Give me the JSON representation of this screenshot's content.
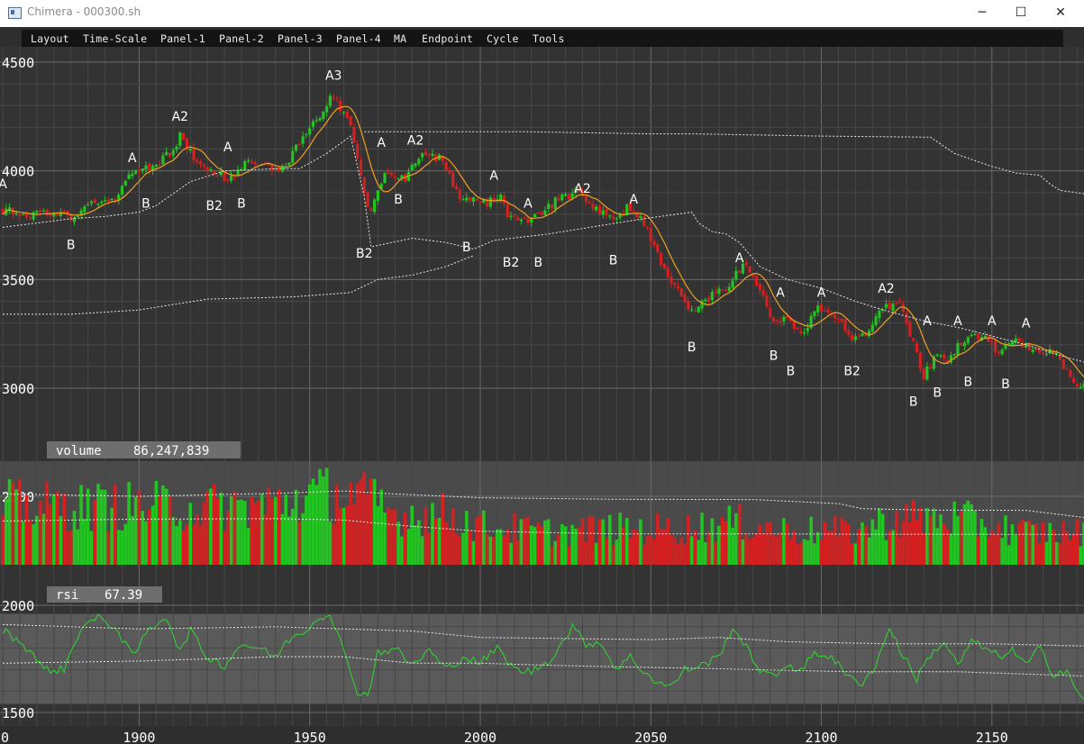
{
  "window": {
    "title": "Chimera - 000300.sh",
    "minimize_glyph": "─",
    "maximize_glyph": "☐",
    "close_glyph": "✕"
  },
  "menu": [
    "Layout",
    "Time-Scale",
    "Panel-1",
    "Panel-2",
    "Panel-3",
    "Panel-4",
    "MA",
    "Endpoint",
    "Cycle",
    "Tools"
  ],
  "colors": {
    "up": "#22c422",
    "down": "#d42020",
    "ma": "#f0a020",
    "rsi_line": "#30d830",
    "grid": "#5a5a5a",
    "label": "#ffffff"
  },
  "panels": {
    "volume": {
      "name": "volume",
      "value": "86,247,839"
    },
    "rsi": {
      "name": "rsi",
      "value": "67.39"
    }
  },
  "chart_data": [
    {
      "type": "candlestick",
      "x_ticks": [
        "1900",
        "1950",
        "2000",
        "2050",
        "2100",
        "2150"
      ],
      "x_edge_label": "0",
      "xlim": [
        1860,
        2177
      ],
      "y_ticks": [
        "4500",
        "4000",
        "3500",
        "3000"
      ],
      "ylim": [
        2960,
        4520
      ],
      "anchors": [
        [
          1860,
          3820
        ],
        [
          1866,
          3800
        ],
        [
          1872,
          3810
        ],
        [
          1880,
          3790
        ],
        [
          1886,
          3850
        ],
        [
          1893,
          3880
        ],
        [
          1898,
          3990
        ],
        [
          1905,
          4020
        ],
        [
          1910,
          4100
        ],
        [
          1912,
          4160
        ],
        [
          1916,
          4060
        ],
        [
          1922,
          3990
        ],
        [
          1927,
          3960
        ],
        [
          1931,
          4030
        ],
        [
          1936,
          4020
        ],
        [
          1942,
          4010
        ],
        [
          1948,
          4150
        ],
        [
          1952,
          4240
        ],
        [
          1957,
          4350
        ],
        [
          1962,
          4200
        ],
        [
          1966,
          3880
        ],
        [
          1968,
          3800
        ],
        [
          1972,
          4010
        ],
        [
          1978,
          3950
        ],
        [
          1982,
          4070
        ],
        [
          1988,
          4060
        ],
        [
          1994,
          3880
        ],
        [
          2002,
          3850
        ],
        [
          2006,
          3900
        ],
        [
          2008,
          3780
        ],
        [
          2013,
          3770
        ],
        [
          2017,
          3790
        ],
        [
          2022,
          3860
        ],
        [
          2028,
          3900
        ],
        [
          2033,
          3840
        ],
        [
          2038,
          3780
        ],
        [
          2043,
          3830
        ],
        [
          2048,
          3760
        ],
        [
          2053,
          3580
        ],
        [
          2058,
          3440
        ],
        [
          2062,
          3360
        ],
        [
          2068,
          3430
        ],
        [
          2073,
          3470
        ],
        [
          2077,
          3570
        ],
        [
          2082,
          3460
        ],
        [
          2086,
          3300
        ],
        [
          2090,
          3340
        ],
        [
          2094,
          3240
        ],
        [
          2099,
          3380
        ],
        [
          2104,
          3340
        ],
        [
          2109,
          3230
        ],
        [
          2113,
          3250
        ],
        [
          2118,
          3360
        ],
        [
          2123,
          3400
        ],
        [
          2127,
          3200
        ],
        [
          2130,
          3060
        ],
        [
          2134,
          3150
        ],
        [
          2137,
          3130
        ],
        [
          2140,
          3190
        ],
        [
          2143,
          3240
        ],
        [
          2148,
          3240
        ],
        [
          2152,
          3160
        ],
        [
          2156,
          3220
        ],
        [
          2162,
          3180
        ],
        [
          2168,
          3170
        ],
        [
          2172,
          3080
        ],
        [
          2176,
          3010
        ]
      ],
      "ma_period": 8,
      "envelope_upper": [
        [
          1966,
          4180
        ],
        [
          2012,
          4180
        ],
        [
          2050,
          4170
        ],
        [
          2062,
          4170
        ],
        [
          2100,
          4160
        ],
        [
          2132,
          4155
        ],
        [
          2139,
          4080
        ],
        [
          2150,
          4020
        ],
        [
          2157,
          3990
        ],
        [
          2164,
          3980
        ],
        [
          2167,
          3940
        ],
        [
          2170,
          3910
        ],
        [
          2177,
          3895
        ]
      ],
      "envelope_lower": [
        [
          1860,
          3740
        ],
        [
          1870,
          3760
        ],
        [
          1880,
          3780
        ],
        [
          1890,
          3790
        ],
        [
          1900,
          3810
        ],
        [
          1905,
          3840
        ],
        [
          1915,
          3950
        ],
        [
          1925,
          4000
        ],
        [
          1940,
          4010
        ],
        [
          1947,
          4010
        ],
        [
          1955,
          4080
        ],
        [
          1962,
          4160
        ],
        [
          1966,
          3880
        ],
        [
          1968,
          3650
        ],
        [
          1980,
          3690
        ],
        [
          1990,
          3670
        ],
        [
          1998,
          3640
        ],
        [
          2004,
          3680
        ],
        [
          2020,
          3710
        ],
        [
          2040,
          3760
        ],
        [
          2048,
          3780
        ],
        [
          2062,
          3810
        ],
        [
          2064,
          3760
        ],
        [
          2068,
          3720
        ],
        [
          2072,
          3710
        ],
        [
          2076,
          3670
        ],
        [
          2082,
          3560
        ],
        [
          2090,
          3500
        ],
        [
          2100,
          3460
        ],
        [
          2110,
          3400
        ],
        [
          2118,
          3360
        ],
        [
          2130,
          3310
        ],
        [
          2140,
          3280
        ],
        [
          2150,
          3240
        ],
        [
          2160,
          3200
        ],
        [
          2170,
          3150
        ],
        [
          2177,
          3120
        ]
      ],
      "envelope_base": [
        [
          1860,
          3340
        ],
        [
          1880,
          3340
        ],
        [
          1900,
          3360
        ],
        [
          1920,
          3410
        ],
        [
          1945,
          3420
        ],
        [
          1962,
          3440
        ],
        [
          1970,
          3500
        ],
        [
          1980,
          3520
        ],
        [
          1990,
          3560
        ],
        [
          1998,
          3610
        ]
      ],
      "cycle_labels": [
        {
          "x": 1860,
          "y": 3920,
          "text": "A"
        },
        {
          "x": 1880,
          "y": 3640,
          "text": "B"
        },
        {
          "x": 1898,
          "y": 4040,
          "text": "A"
        },
        {
          "x": 1902,
          "y": 3830,
          "text": "B"
        },
        {
          "x": 1912,
          "y": 4230,
          "text": "A2"
        },
        {
          "x": 1922,
          "y": 3820,
          "text": "B2"
        },
        {
          "x": 1926,
          "y": 4090,
          "text": "A"
        },
        {
          "x": 1930,
          "y": 3830,
          "text": "B"
        },
        {
          "x": 1957,
          "y": 4420,
          "text": "A3"
        },
        {
          "x": 1966,
          "y": 3600,
          "text": "B2"
        },
        {
          "x": 1971,
          "y": 4110,
          "text": "A"
        },
        {
          "x": 1976,
          "y": 3850,
          "text": "B"
        },
        {
          "x": 1981,
          "y": 4120,
          "text": "A2"
        },
        {
          "x": 1996,
          "y": 3630,
          "text": "B"
        },
        {
          "x": 2004,
          "y": 3960,
          "text": "A"
        },
        {
          "x": 2009,
          "y": 3560,
          "text": "B2"
        },
        {
          "x": 2014,
          "y": 3830,
          "text": "A"
        },
        {
          "x": 2017,
          "y": 3560,
          "text": "B"
        },
        {
          "x": 2030,
          "y": 3900,
          "text": "A2"
        },
        {
          "x": 2039,
          "y": 3570,
          "text": "B"
        },
        {
          "x": 2045,
          "y": 3850,
          "text": "A"
        },
        {
          "x": 2062,
          "y": 3170,
          "text": "B"
        },
        {
          "x": 2076,
          "y": 3580,
          "text": "A"
        },
        {
          "x": 2086,
          "y": 3130,
          "text": "B"
        },
        {
          "x": 2088,
          "y": 3420,
          "text": "A"
        },
        {
          "x": 2091,
          "y": 3060,
          "text": "B"
        },
        {
          "x": 2100,
          "y": 3420,
          "text": "A"
        },
        {
          "x": 2109,
          "y": 3060,
          "text": "B2"
        },
        {
          "x": 2119,
          "y": 3440,
          "text": "A2"
        },
        {
          "x": 2127,
          "y": 2920,
          "text": "B"
        },
        {
          "x": 2131,
          "y": 3290,
          "text": "A"
        },
        {
          "x": 2134,
          "y": 2960,
          "text": "B"
        },
        {
          "x": 2140,
          "y": 3290,
          "text": "A"
        },
        {
          "x": 2143,
          "y": 3010,
          "text": "B"
        },
        {
          "x": 2150,
          "y": 3290,
          "text": "A"
        },
        {
          "x": 2154,
          "y": 3000,
          "text": "B"
        },
        {
          "x": 2160,
          "y": 3280,
          "text": "A"
        }
      ]
    },
    {
      "type": "bar",
      "name": "volume",
      "y_ticks": [
        "2500"
      ],
      "ylim": [
        0,
        3600
      ],
      "anchors": [
        [
          1860,
          2400
        ],
        [
          1880,
          2300
        ],
        [
          1900,
          2350
        ],
        [
          1920,
          2300
        ],
        [
          1940,
          2400
        ],
        [
          1950,
          2750
        ],
        [
          1960,
          2800
        ],
        [
          1965,
          2700
        ],
        [
          1975,
          2050
        ],
        [
          1990,
          2050
        ],
        [
          2000,
          1600
        ],
        [
          2020,
          1400
        ],
        [
          2040,
          1500
        ],
        [
          2060,
          1500
        ],
        [
          2075,
          1750
        ],
        [
          2090,
          1450
        ],
        [
          2110,
          1400
        ],
        [
          2120,
          1850
        ],
        [
          2130,
          1900
        ],
        [
          2140,
          1900
        ],
        [
          2150,
          1600
        ],
        [
          2160,
          1400
        ],
        [
          2177,
          1350
        ]
      ],
      "band_upper": [
        [
          1860,
          2580
        ],
        [
          1900,
          2500
        ],
        [
          1940,
          2600
        ],
        [
          1960,
          2680
        ],
        [
          1975,
          2580
        ],
        [
          2000,
          2450
        ],
        [
          2040,
          2400
        ],
        [
          2080,
          2390
        ],
        [
          2105,
          2250
        ],
        [
          2112,
          2080
        ],
        [
          2130,
          2030
        ],
        [
          2160,
          2020
        ],
        [
          2177,
          1780
        ]
      ],
      "band_lower": [
        [
          1860,
          1660
        ],
        [
          1900,
          1720
        ],
        [
          1940,
          1740
        ],
        [
          1960,
          1690
        ],
        [
          1980,
          1480
        ],
        [
          2000,
          1310
        ],
        [
          2040,
          1220
        ],
        [
          2080,
          1220
        ],
        [
          2110,
          1210
        ],
        [
          2140,
          1210
        ],
        [
          2177,
          1200
        ]
      ]
    },
    {
      "type": "line",
      "name": "rsi",
      "y_ticks": [
        "2000",
        "1500"
      ],
      "ylim": [
        1500,
        2000
      ],
      "anchors": [
        [
          1860,
          1885
        ],
        [
          1865,
          1830
        ],
        [
          1868,
          1790
        ],
        [
          1872,
          1700
        ],
        [
          1878,
          1700
        ],
        [
          1883,
          1900
        ],
        [
          1888,
          1940
        ],
        [
          1893,
          1900
        ],
        [
          1898,
          1760
        ],
        [
          1903,
          1890
        ],
        [
          1908,
          1950
        ],
        [
          1912,
          1780
        ],
        [
          1915,
          1890
        ],
        [
          1918,
          1800
        ],
        [
          1920,
          1760
        ],
        [
          1925,
          1720
        ],
        [
          1930,
          1820
        ],
        [
          1935,
          1800
        ],
        [
          1940,
          1760
        ],
        [
          1944,
          1840
        ],
        [
          1947,
          1870
        ],
        [
          1950,
          1900
        ],
        [
          1953,
          1950
        ],
        [
          1956,
          1960
        ],
        [
          1958,
          1880
        ],
        [
          1961,
          1730
        ],
        [
          1964,
          1600
        ],
        [
          1967,
          1580
        ],
        [
          1970,
          1780
        ],
        [
          1975,
          1800
        ],
        [
          1980,
          1720
        ],
        [
          1985,
          1790
        ],
        [
          1990,
          1700
        ],
        [
          1995,
          1760
        ],
        [
          2000,
          1730
        ],
        [
          2005,
          1800
        ],
        [
          2010,
          1700
        ],
        [
          2015,
          1690
        ],
        [
          2020,
          1740
        ],
        [
          2023,
          1800
        ],
        [
          2027,
          1900
        ],
        [
          2031,
          1820
        ],
        [
          2035,
          1830
        ],
        [
          2040,
          1700
        ],
        [
          2044,
          1760
        ],
        [
          2048,
          1690
        ],
        [
          2052,
          1640
        ],
        [
          2056,
          1620
        ],
        [
          2060,
          1700
        ],
        [
          2065,
          1720
        ],
        [
          2070,
          1760
        ],
        [
          2074,
          1900
        ],
        [
          2078,
          1800
        ],
        [
          2082,
          1700
        ],
        [
          2086,
          1660
        ],
        [
          2090,
          1730
        ],
        [
          2094,
          1690
        ],
        [
          2098,
          1780
        ],
        [
          2103,
          1760
        ],
        [
          2108,
          1660
        ],
        [
          2112,
          1640
        ],
        [
          2116,
          1720
        ],
        [
          2120,
          1900
        ],
        [
          2124,
          1760
        ],
        [
          2128,
          1660
        ],
        [
          2132,
          1770
        ],
        [
          2136,
          1830
        ],
        [
          2140,
          1720
        ],
        [
          2144,
          1830
        ],
        [
          2148,
          1800
        ],
        [
          2152,
          1760
        ],
        [
          2156,
          1790
        ],
        [
          2160,
          1720
        ],
        [
          2164,
          1800
        ],
        [
          2168,
          1680
        ],
        [
          2172,
          1700
        ],
        [
          2176,
          1560
        ]
      ],
      "band_upper": [
        [
          1860,
          1910
        ],
        [
          1900,
          1890
        ],
        [
          1940,
          1900
        ],
        [
          1960,
          1890
        ],
        [
          1980,
          1880
        ],
        [
          2000,
          1850
        ],
        [
          2050,
          1840
        ],
        [
          2070,
          1850
        ],
        [
          2090,
          1830
        ],
        [
          2120,
          1820
        ],
        [
          2150,
          1820
        ],
        [
          2177,
          1810
        ]
      ],
      "band_lower": [
        [
          1860,
          1730
        ],
        [
          1900,
          1740
        ],
        [
          1940,
          1760
        ],
        [
          1960,
          1760
        ],
        [
          1980,
          1730
        ],
        [
          2000,
          1730
        ],
        [
          2020,
          1720
        ],
        [
          2050,
          1710
        ],
        [
          2080,
          1700
        ],
        [
          2110,
          1690
        ],
        [
          2140,
          1690
        ],
        [
          2177,
          1670
        ]
      ]
    }
  ]
}
